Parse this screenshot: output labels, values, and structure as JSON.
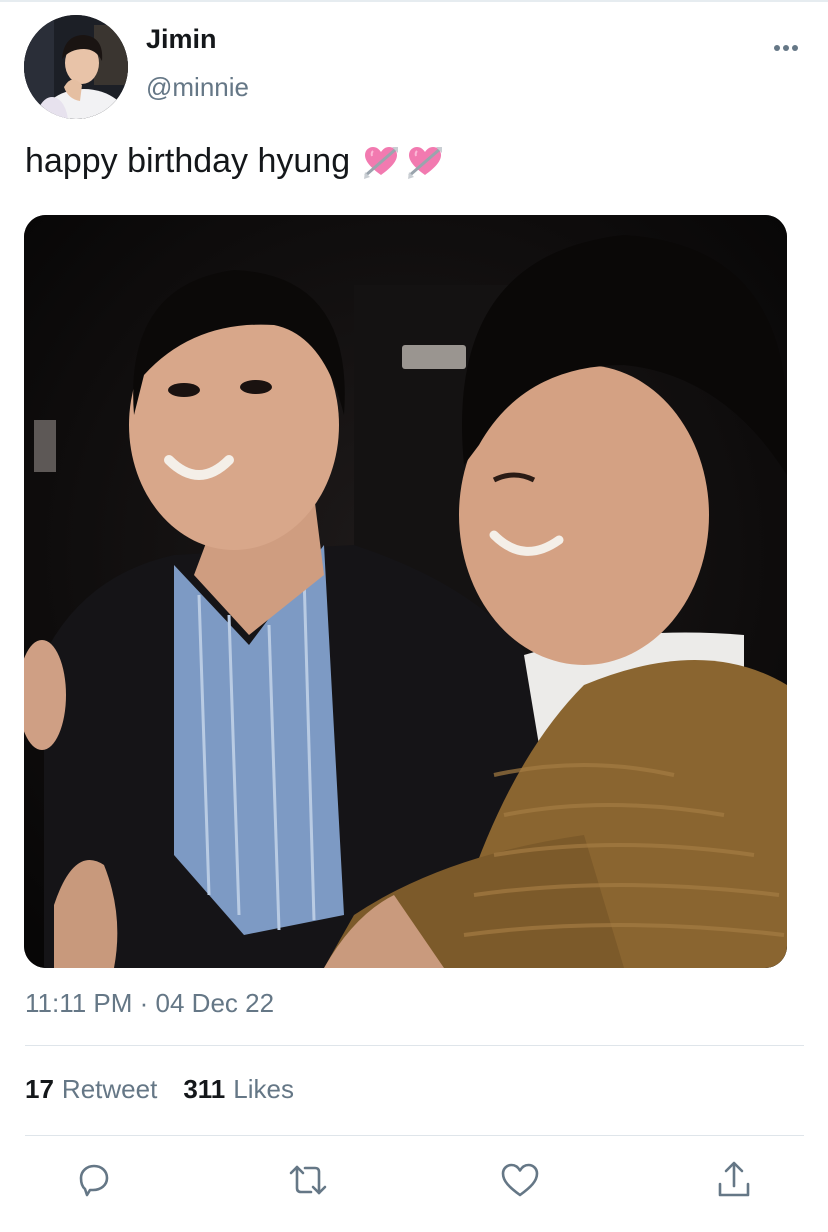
{
  "tweet": {
    "author": {
      "display_name": "Jimin",
      "handle": "@minnie"
    },
    "text": "happy birthday hyung",
    "emojis": [
      "heart-with-arrow-emoji",
      "heart-with-arrow-emoji"
    ],
    "timestamp": "11:11 PM · 04 Dec 22",
    "stats": {
      "retweets_count": "17",
      "retweets_label": "Retweet",
      "likes_count": "311",
      "likes_label": "Likes"
    }
  },
  "icons": {
    "more": "more-horizontal-icon",
    "reply": "reply-icon",
    "retweet": "retweet-icon",
    "like": "heart-icon",
    "share": "share-icon"
  },
  "colors": {
    "text_primary": "#14171a",
    "text_secondary": "#657786",
    "divider": "#dfe5ea",
    "icon": "#657786",
    "emoji_heart": "#f27ab0"
  }
}
